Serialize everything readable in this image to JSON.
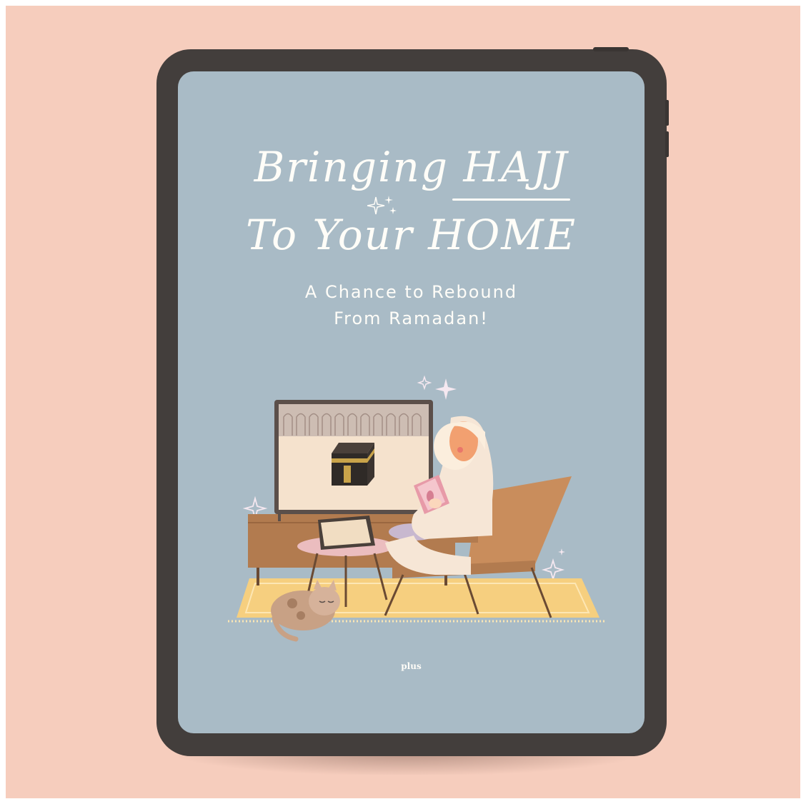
{
  "cover": {
    "title_line1": "Bringing HAJJ",
    "title_line2": "To Your HOME",
    "subtitle_line1": "A Chance to Rebound",
    "subtitle_line2": "From Ramadan!",
    "brand": "plus"
  },
  "colors": {
    "background": "#f6cdbd",
    "tablet_bezel": "#433e3c",
    "screen": "#a9bbc6",
    "text": "#fffdf8"
  },
  "icons": [
    "sparkle-icon",
    "kaaba-illustration",
    "cat-illustration",
    "reading-woman-illustration"
  ]
}
